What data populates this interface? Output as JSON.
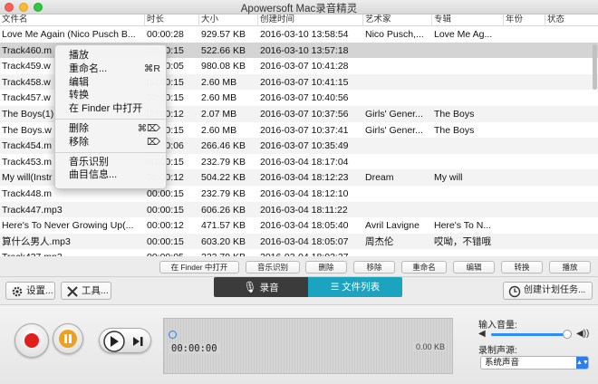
{
  "window": {
    "title": "Apowersoft Mac录音精灵"
  },
  "table": {
    "columns": [
      "文件名",
      "时长",
      "大小",
      "创建时间",
      "艺术家",
      "专辑",
      "年份",
      "状态"
    ],
    "rows": [
      [
        "Love Me Again (Nico Pusch B...",
        "00:00:28",
        "929.57 KB",
        "2016-03-10 13:58:54",
        "Nico Pusch,...",
        "Love Me Ag...",
        "",
        ""
      ],
      [
        "Track460.m",
        "00:00:15",
        "522.66 KB",
        "2016-03-10 13:57:18",
        "",
        "",
        "",
        ""
      ],
      [
        "Track459.w",
        "00:00:05",
        "980.08 KB",
        "2016-03-07 10:41:28",
        "",
        "",
        "",
        ""
      ],
      [
        "Track458.w",
        "00:00:15",
        "2.60 MB",
        "2016-03-07 10:41:15",
        "",
        "",
        "",
        ""
      ],
      [
        "Track457.w",
        "00:00:15",
        "2.60 MB",
        "2016-03-07 10:40:56",
        "",
        "",
        "",
        ""
      ],
      [
        "The Boys(1)",
        "00:00:12",
        "2.07 MB",
        "2016-03-07 10:37:56",
        "Girls' Gener...",
        "The Boys",
        "",
        ""
      ],
      [
        "The Boys.w",
        "00:00:15",
        "2.60 MB",
        "2016-03-07 10:37:41",
        "Girls' Gener...",
        "The Boys",
        "",
        ""
      ],
      [
        "Track454.m",
        "00:00:06",
        "266.46 KB",
        "2016-03-07 10:35:49",
        "",
        "",
        "",
        ""
      ],
      [
        "Track453.m",
        "00:00:15",
        "232.79 KB",
        "2016-03-04 18:17:04",
        "",
        "",
        "",
        ""
      ],
      [
        "My will(Instr",
        "00:00:12",
        "504.22 KB",
        "2016-03-04 18:12:23",
        "Dream",
        "My will",
        "",
        ""
      ],
      [
        "Track448.m",
        "00:00:15",
        "232.79 KB",
        "2016-03-04 18:12:10",
        "",
        "",
        "",
        ""
      ],
      [
        "Track447.mp3",
        "00:00:15",
        "606.26 KB",
        "2016-03-04 18:11:22",
        "",
        "",
        "",
        ""
      ],
      [
        "Here's To Never Growing Up(...",
        "00:00:12",
        "471.57 KB",
        "2016-03-04 18:05:40",
        "Avril Lavigne",
        "Here's To N...",
        "",
        ""
      ],
      [
        "算什么男人.mp3",
        "00:00:15",
        "603.20 KB",
        "2016-03-04 18:05:07",
        "周杰伦",
        "哎呦，不错哦",
        "",
        ""
      ],
      [
        "Track437.mp3",
        "00:00:05",
        "232.79 KB",
        "2016-03-04 18:03:37",
        "",
        "",
        "",
        ""
      ],
      [
        "",
        "",
        "",
        "",
        "",
        "",
        "",
        ""
      ]
    ]
  },
  "context_menu": {
    "items": [
      {
        "label": "播放",
        "shortcut": ""
      },
      {
        "label": "重命名...",
        "shortcut": "⌘R"
      },
      {
        "label": "编辑",
        "shortcut": ""
      },
      {
        "label": "转换",
        "shortcut": ""
      },
      {
        "label": "在 Finder 中打开",
        "shortcut": ""
      },
      {
        "sep": true
      },
      {
        "label": "删除",
        "shortcut": "⌘⌦"
      },
      {
        "label": "移除",
        "shortcut": "⌦"
      },
      {
        "sep": true
      },
      {
        "label": "音乐识别",
        "shortcut": ""
      },
      {
        "label": "曲目信息...",
        "shortcut": ""
      }
    ]
  },
  "action_buttons": [
    "在 Finder 中打开",
    "音乐识别",
    "删除",
    "移除",
    "重命名",
    "编辑",
    "转换",
    "播放"
  ],
  "toolbar": {
    "settings_label": "设置...",
    "tools_label": "工具...",
    "tab_record": "录音",
    "tab_files": "文件列表",
    "schedule_label": "创建计划任务..."
  },
  "player": {
    "time": "00:00:00",
    "size": "0.00 KB",
    "volume_label": "输入音量:",
    "volume_level": 0.95,
    "source_label": "录制声源:",
    "source_value": "系统声音"
  },
  "colors": {
    "accent": "#1ba3bf",
    "record": "#e0201c",
    "pause": "#f0a020"
  }
}
